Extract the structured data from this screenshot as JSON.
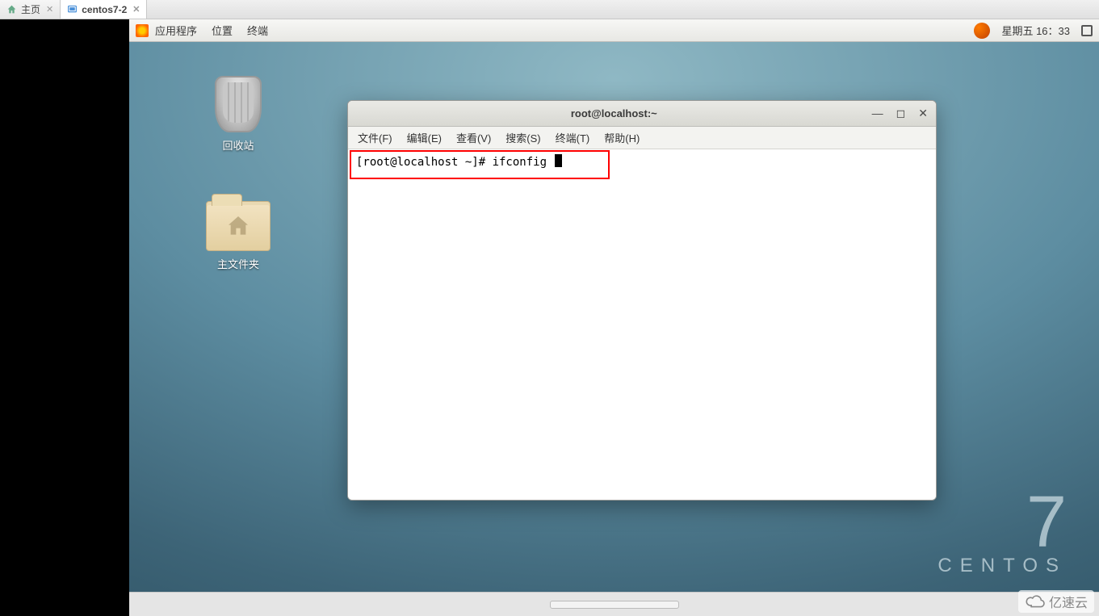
{
  "host_tabs": [
    {
      "label": "主页",
      "icon": "home-icon"
    },
    {
      "label": "centos7-2",
      "icon": "vm-icon"
    }
  ],
  "gnome_bar": {
    "applications": "应用程序",
    "places": "位置",
    "terminal": "终端",
    "datetime": "星期五 16：33"
  },
  "desktop_icons": {
    "trash_label": "回收站",
    "home_label": "主文件夹"
  },
  "terminal": {
    "title": "root@localhost:~",
    "menu": {
      "file": "文件(F)",
      "edit": "编辑(E)",
      "view": "查看(V)",
      "search": "搜索(S)",
      "terminal": "终端(T)",
      "help": "帮助(H)"
    },
    "prompt": "[root@localhost ~]# ifconfig "
  },
  "centos_brand": {
    "numeral": "7",
    "word": "CENTOS"
  },
  "cloud_badge": "亿速云"
}
